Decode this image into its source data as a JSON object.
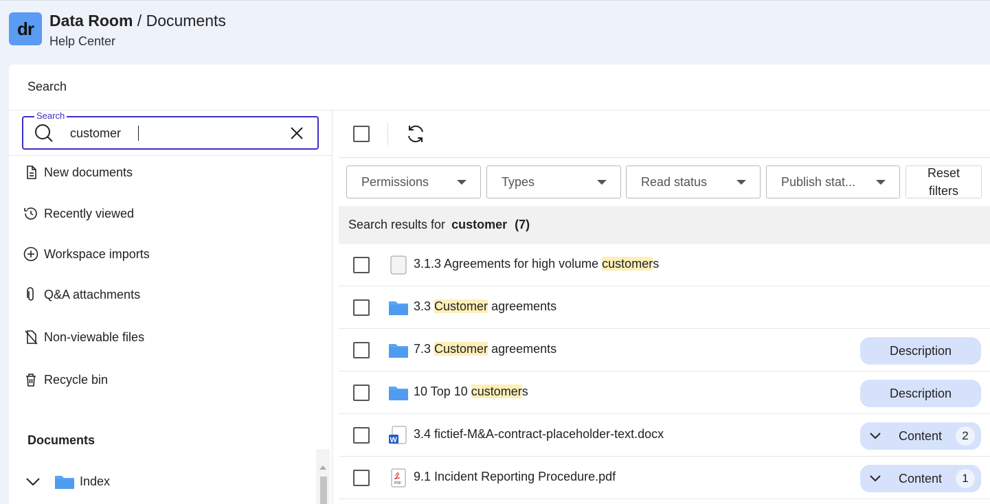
{
  "header": {
    "logo_text": "dr",
    "title_strong": "Data Room",
    "title_sep": " / ",
    "title_rest": "Documents",
    "subtitle": "Help Center"
  },
  "panel": {
    "heading": "Search"
  },
  "search": {
    "legend": "Search",
    "value": "customer"
  },
  "nav": [
    {
      "label": "New documents",
      "icon": "new-document-icon"
    },
    {
      "label": "Recently viewed",
      "icon": "history-icon"
    },
    {
      "label": "Workspace imports",
      "icon": "plus-circle-icon"
    },
    {
      "label": "Q&A attachments",
      "icon": "paperclip-icon"
    },
    {
      "label": "Non-viewable files",
      "icon": "file-off-icon"
    },
    {
      "label": "Recycle bin",
      "icon": "trash-icon"
    }
  ],
  "documents_section": {
    "title": "Documents",
    "tree_item": "Index"
  },
  "filters": [
    {
      "label": "Permissions"
    },
    {
      "label": "Types"
    },
    {
      "label": "Read status"
    },
    {
      "label": "Publish stat..."
    }
  ],
  "reset_filters": {
    "line1": "Reset",
    "line2": "filters"
  },
  "results": {
    "prefix": "Search results for",
    "query": "customer",
    "count": "(7)"
  },
  "rows": [
    {
      "pre": "3.1.3 Agreements for high volume ",
      "match": "customer",
      "post": "s",
      "icon": "document-icon",
      "action": null
    },
    {
      "pre": "3.3 ",
      "match": "Customer",
      "post": " agreements",
      "icon": "folder-icon",
      "action": null
    },
    {
      "pre": "7.3 ",
      "match": "Customer",
      "post": " agreements",
      "icon": "folder-icon",
      "action": {
        "type": "description",
        "label": "Description"
      }
    },
    {
      "pre": "10 Top 10 ",
      "match": "customer",
      "post": "s",
      "icon": "folder-icon",
      "action": {
        "type": "description",
        "label": "Description"
      }
    },
    {
      "pre": "3.4 fictief-M&A-contract-placeholder-text.docx",
      "match": "",
      "post": "",
      "icon": "word-file-icon",
      "action": {
        "type": "content",
        "label": "Content",
        "count": "2"
      }
    },
    {
      "pre": "9.1 Incident Reporting Procedure.pdf",
      "match": "",
      "post": "",
      "icon": "pdf-file-icon",
      "action": {
        "type": "content",
        "label": "Content",
        "count": "1"
      }
    }
  ],
  "colors": {
    "accent": "#3b2fc9",
    "logo": "#5a9bf3",
    "folder": "#5aa5f5",
    "highlight": "#fdefb8",
    "pill": "#d6e2fb"
  }
}
